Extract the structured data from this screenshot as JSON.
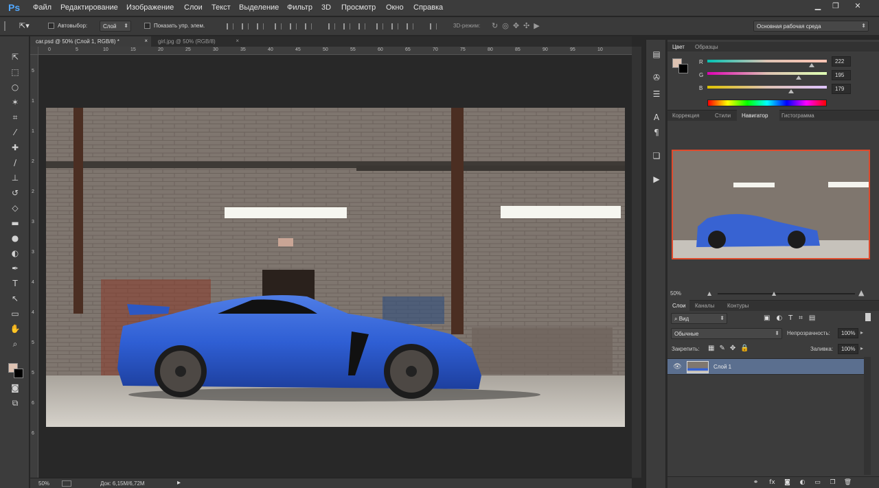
{
  "app": {
    "logo": "Ps"
  },
  "menu": [
    "Файл",
    "Редактирование",
    "Изображение",
    "Слои",
    "Текст",
    "Выделение",
    "Фильтр",
    "3D",
    "Просмотр",
    "Окно",
    "Справка"
  ],
  "options": {
    "autoselect_label": "Автовыбор:",
    "autoselect_value": "Слой",
    "show_transform_label": "Показать упр. элем.",
    "mode_3d_label": "3D-режим:",
    "workspace": "Основная рабочая среда"
  },
  "tabs": [
    {
      "label": "car.psd @ 50% (Слой 1, RGB/8) *",
      "active": true
    },
    {
      "label": "girl.jpg @ 50% (RGB/8)",
      "active": false
    }
  ],
  "ruler_h": [
    "0",
    "5",
    "10",
    "15",
    "20",
    "25",
    "30",
    "35",
    "40",
    "45",
    "50",
    "55",
    "60",
    "65",
    "70",
    "75",
    "80",
    "85",
    "90",
    "95",
    "10"
  ],
  "ruler_v": [
    "5",
    "1",
    "1",
    "2",
    "2",
    "3",
    "3",
    "4",
    "4",
    "5",
    "5",
    "6",
    "6"
  ],
  "status": {
    "zoom": "50%",
    "doc": "Док: 6,15M/6,72M"
  },
  "color_panel": {
    "tabs": [
      "Цвет",
      "Образцы"
    ],
    "r_label": "R",
    "g_label": "G",
    "b_label": "B",
    "r": "222",
    "g": "195",
    "b": "179",
    "r_frac": 0.871,
    "g_frac": 0.765,
    "b_frac": 0.702,
    "foreground": "#dec3b3",
    "background": "#000000"
  },
  "nav_panel": {
    "tabs": [
      "Коррекция",
      "Стили",
      "Навигатор",
      "Гистограмма"
    ],
    "zoom": "50%",
    "view_box_color": "#e04a2c"
  },
  "layers_panel": {
    "tabs": [
      "Слои",
      "Каналы",
      "Контуры"
    ],
    "filter": "Вид",
    "blend": "Обычные",
    "opacity_label": "Непрозрачность:",
    "opacity": "100%",
    "lock_label": "Закрепить:",
    "fill_label": "Заливка:",
    "fill": "100%",
    "layers": [
      {
        "name": "Слой 1",
        "selected": true,
        "visible": true
      }
    ]
  },
  "colors": {
    "accent": "#51a8ff",
    "selected_layer": "#5b6f8f"
  }
}
